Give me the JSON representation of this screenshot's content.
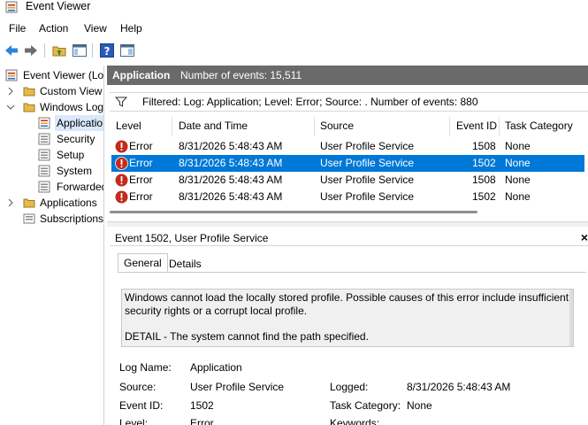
{
  "window": {
    "title": "Event Viewer"
  },
  "menu": [
    "File",
    "Action",
    "View",
    "Help"
  ],
  "toolbar": {
    "buttons": [
      "back-arrow-icon",
      "forward-arrow-icon",
      "folder-up-icon",
      "show-hide-tree-icon",
      "help-icon",
      "action-pane-icon"
    ]
  },
  "tree": {
    "root": "Event Viewer (Loc",
    "custom_views": "Custom View",
    "windows_logs": "Windows Log",
    "application": "Applicatio",
    "security": "Security",
    "setup": "Setup",
    "system": "System",
    "forwarded": "Forwarded",
    "applications": "Applications",
    "subscriptions": "Subscriptions"
  },
  "header": {
    "name": "Application",
    "count": "Number of events: 15,511"
  },
  "filter": {
    "text": "Filtered: Log: Application; Level: Error; Source: . Number of events: 880"
  },
  "columns": [
    "Level",
    "Date and Time",
    "Source",
    "Event ID",
    "Task Category"
  ],
  "events": [
    {
      "level": "Error",
      "date": "8/31/2026 5:48:43 AM",
      "source": "User Profile Service",
      "event_id": "1508",
      "task": "None"
    },
    {
      "level": "Error",
      "date": "8/31/2026 5:48:43 AM",
      "source": "User Profile Service",
      "event_id": "1502",
      "task": "None"
    },
    {
      "level": "Error",
      "date": "8/31/2026 5:48:43 AM",
      "source": "User Profile Service",
      "event_id": "1508",
      "task": "None"
    },
    {
      "level": "Error",
      "date": "8/31/2026 5:48:43 AM",
      "source": "User Profile Service",
      "event_id": "1502",
      "task": "None"
    }
  ],
  "detail": {
    "title": "Event 1502, User Profile Service",
    "close": "×",
    "tabs": [
      "General",
      "Details"
    ],
    "message": "Windows cannot load the locally stored profile. Possible causes of this error include insufficient security rights or a corrupt local profile.",
    "message_detail": "DETAIL - The system cannot find the path specified.",
    "props": {
      "log_name_label": "Log Name:",
      "log_name": "Application",
      "source_label": "Source:",
      "source": "User Profile Service",
      "logged_label": "Logged:",
      "logged": "8/31/2026 5:48:43 AM",
      "event_id_label": "Event ID:",
      "event_id": "1502",
      "task_label": "Task Category:",
      "task": "None",
      "level_label": "Level:",
      "level": "Error",
      "keywords_label": "Keywords:"
    }
  },
  "colors": {
    "selection": "#0078d7",
    "header_bar": "#6a6a6a",
    "error_red": "#c42b1c"
  }
}
